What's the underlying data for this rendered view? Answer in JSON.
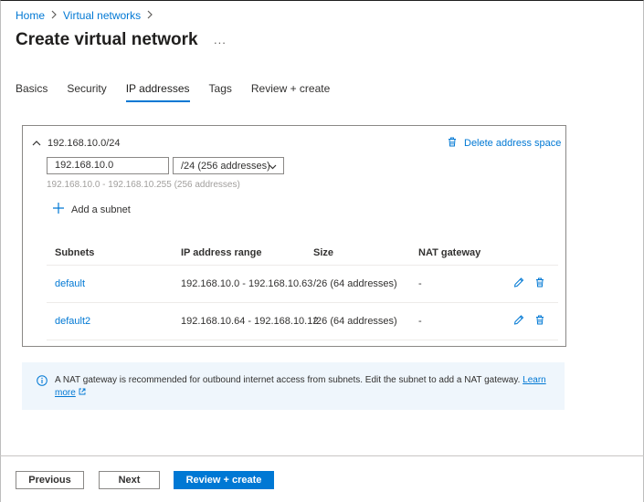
{
  "breadcrumb": {
    "home": "Home",
    "virtual_networks": "Virtual networks"
  },
  "page": {
    "title": "Create virtual network",
    "more": "..."
  },
  "tabs": [
    {
      "label": "Basics"
    },
    {
      "label": "Security"
    },
    {
      "label": "IP addresses",
      "active": true
    },
    {
      "label": "Tags"
    },
    {
      "label": "Review + create"
    }
  ],
  "address_space": {
    "label": "192.168.10.0/24",
    "delete_label": "Delete address space",
    "ip_value": "192.168.10.0",
    "cidr_value": "/24 (256 addresses)",
    "range_note": "192.168.10.0 - 192.168.10.255 (256 addresses)",
    "add_subnet_label": "Add a subnet"
  },
  "subnet_table": {
    "headers": [
      "Subnets",
      "IP address range",
      "Size",
      "NAT gateway"
    ],
    "rows": [
      {
        "name": "default",
        "range": "192.168.10.0 - 192.168.10.63",
        "size": "/26 (64 addresses)",
        "nat": "-"
      },
      {
        "name": "default2",
        "range": "192.168.10.64 - 192.168.10.12",
        "size": "/26 (64 addresses)",
        "nat": "-"
      }
    ]
  },
  "info": {
    "text": "A NAT gateway is recommended for outbound internet access from subnets. Edit the subnet to add a NAT gateway.",
    "learn": "Learn",
    "more": "more"
  },
  "footer": {
    "previous": "Previous",
    "next": "Next",
    "review_create": "Review + create"
  },
  "colors": {
    "accent": "#0078d4",
    "info_bg": "#eff6fc",
    "border": "#8a8886"
  }
}
